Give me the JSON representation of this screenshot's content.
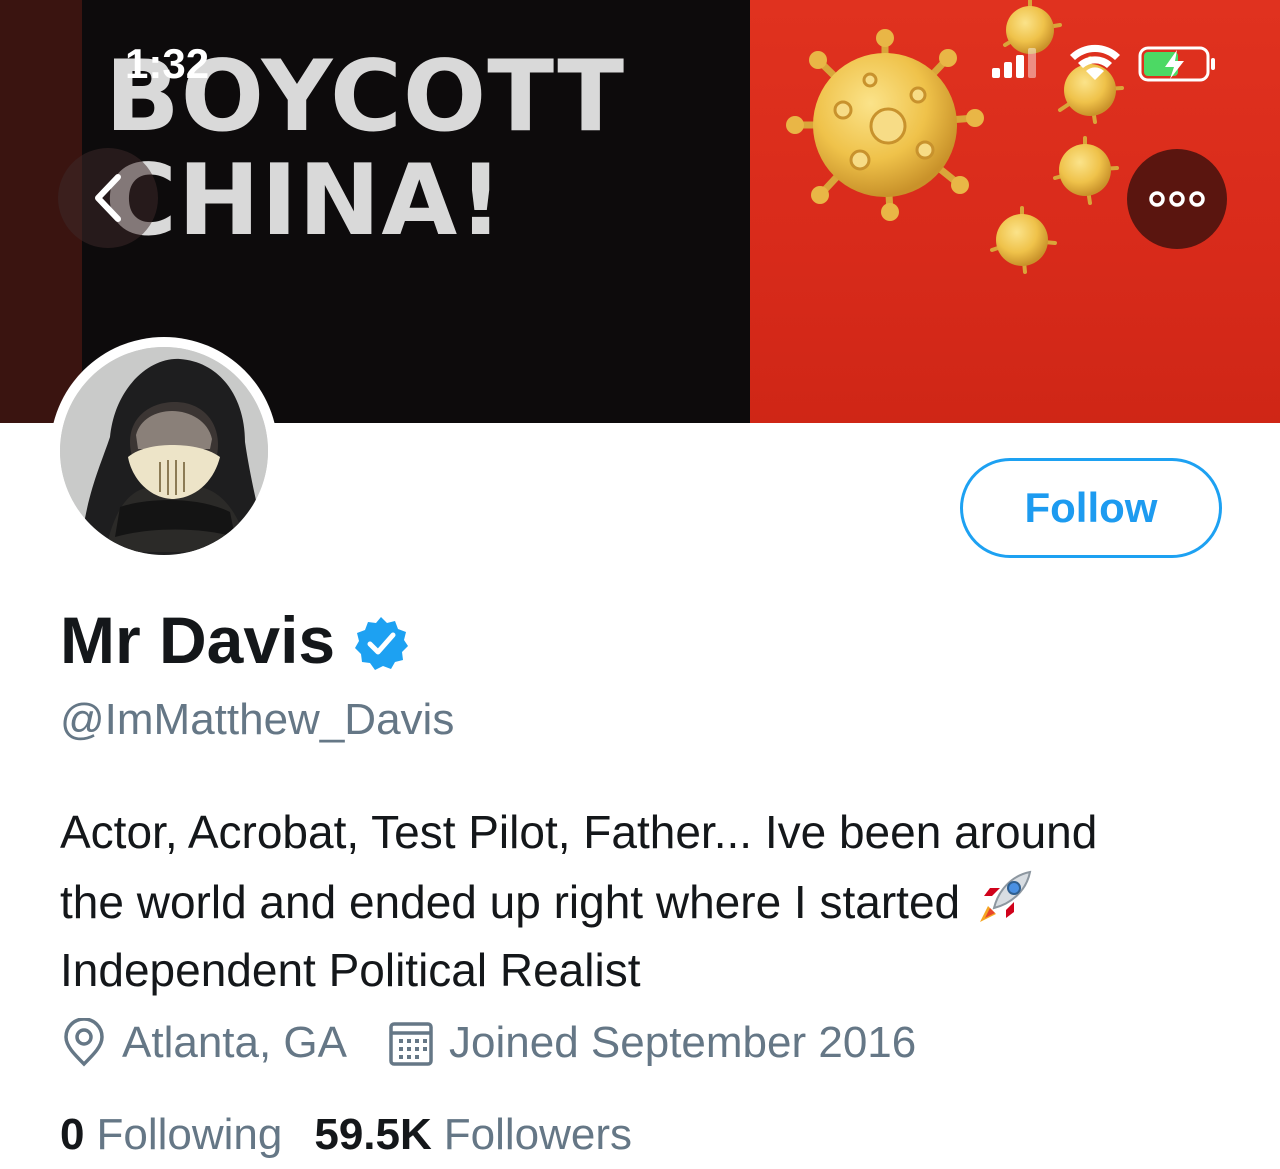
{
  "status_bar": {
    "time": "1:32",
    "icons": [
      "cellular-signal-icon",
      "wifi-icon",
      "battery-charging-icon"
    ],
    "battery_color": "#4cd964"
  },
  "header_banner": {
    "line1": "BOYCOTT",
    "line2": "CHINA!",
    "colors": {
      "black_panel": "#0d0b0c",
      "red_panel": "#d92b1b",
      "text": "#d9d9d9",
      "virus": "#f2c94c"
    }
  },
  "nav": {
    "back_icon": "chevron-left-icon",
    "more_icon": "more-options-icon"
  },
  "profile": {
    "display_name": "Mr Davis",
    "verified": true,
    "verified_color": "#1da1f2",
    "handle": "@ImMatthew_Davis",
    "follow_label": "Follow",
    "accent_color": "#1da1f2",
    "bio_lines": [
      "Actor, Acrobat, Test Pilot, Father... Ive been around",
      "the world and ended up right where I started",
      "Independent Political Realist"
    ],
    "bio_emoji": "rocket-emoji",
    "location": "Atlanta, GA",
    "joined": "Joined September 2016",
    "following_count": "0",
    "following_label": "Following",
    "followers_count": "59.5K",
    "followers_label": "Followers"
  }
}
